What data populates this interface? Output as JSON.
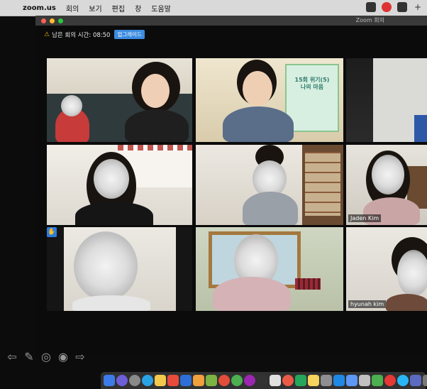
{
  "menubar": {
    "apple_glyph": "",
    "app": "zoom.us",
    "items": [
      "회의",
      "보기",
      "편집",
      "창",
      "도움말"
    ]
  },
  "window": {
    "title": "Zoom 회의",
    "notice_text": "남은 회의 시간: 08:50",
    "upgrade_label": "업그레이드"
  },
  "participants": [
    {
      "name": ""
    },
    {
      "name": ""
    },
    {
      "name": ""
    },
    {
      "name": ""
    },
    {
      "name": ""
    },
    {
      "name": "Jaden Kim"
    },
    {
      "name": ""
    },
    {
      "name": ""
    },
    {
      "name": "hyunah kim"
    }
  ],
  "poster_text": "15회 위기(5)\n나의 마음",
  "icons": {
    "warning": "⚠",
    "raise_hand": "✋"
  },
  "colors": {
    "menubar_bg": "#d9d9d9",
    "window_bg": "#0b0b0b",
    "upgrade_blue": "#3c8be0",
    "raise_blue": "#2d7de0"
  }
}
